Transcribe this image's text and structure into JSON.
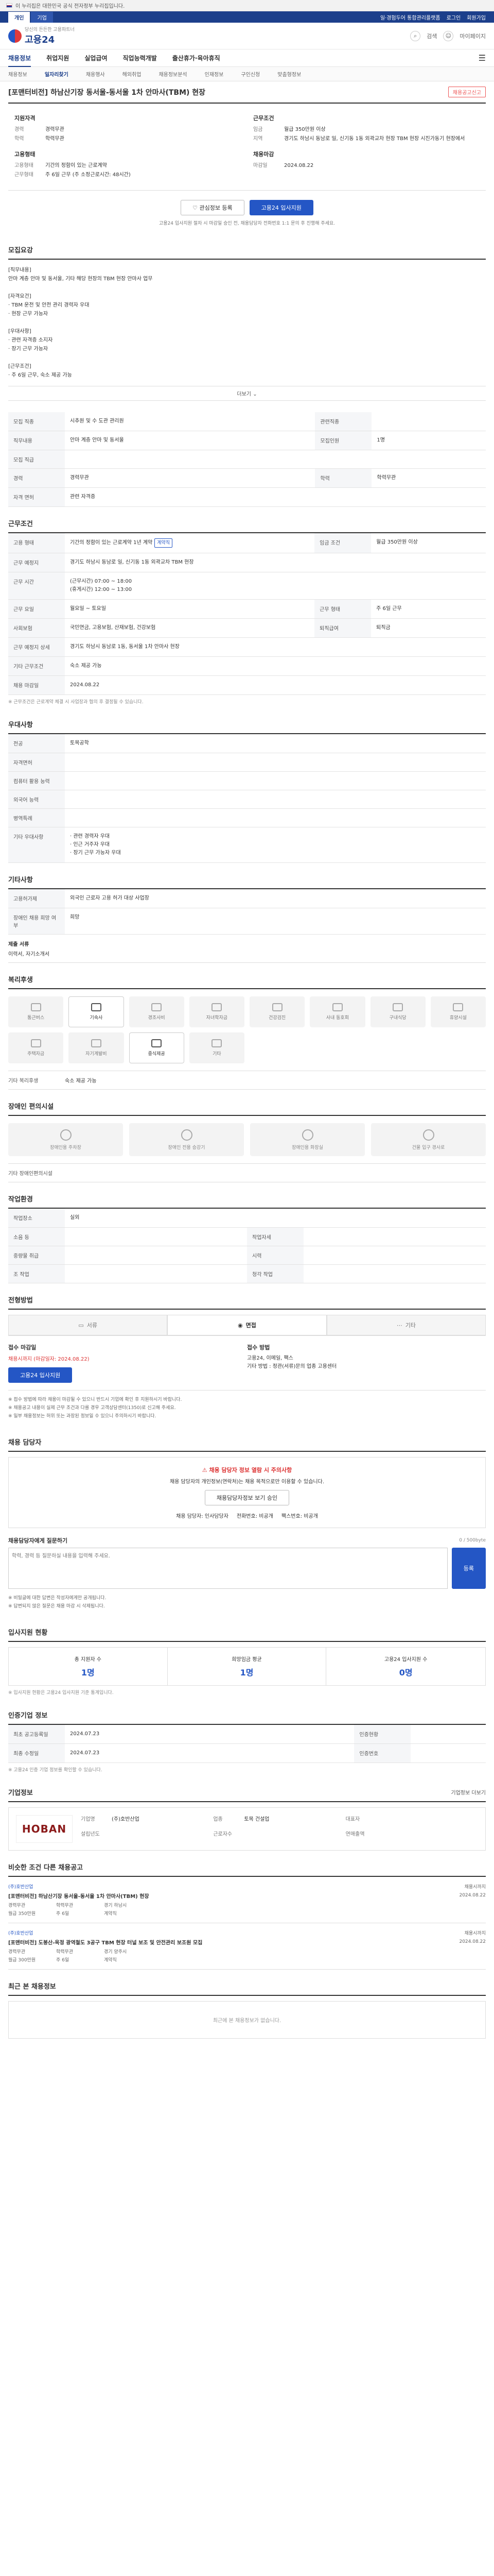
{
  "gov": {
    "text": "이 누리집은 대한민국 공식 전자정부 누리집입니다."
  },
  "util": {
    "tabs": [
      "개인",
      "기업"
    ],
    "links": [
      "일·경험두어 통합관리플랫폼",
      "로그인",
      "회원가입"
    ]
  },
  "header": {
    "logo": "고용24",
    "logo_sub": "당신의 든든한 고용파트너",
    "search_label": "검색",
    "mypage_label": "마이페이지"
  },
  "gnb": [
    "채용정보",
    "취업지원",
    "실업급여",
    "직업능력개발",
    "출산휴가·육아휴직",
    "전체메뉴"
  ],
  "lnb": [
    "채용정보",
    "일자리찾기",
    "채용행사",
    "해외취업",
    "채용정보분석",
    "인재정보",
    "구인신청",
    "맞춤형정보"
  ],
  "job": {
    "title": "[포맨터비전] 하남산기장 동서울-동서울 1차 안마사(TBM) 현장",
    "report": "채용공고신고"
  },
  "summary": {
    "recruit_title": "지원자격",
    "recruit": [
      {
        "k": "경력",
        "v": "경력무관"
      },
      {
        "k": "학력",
        "v": "학력무관"
      }
    ],
    "cond_title": "근무조건",
    "cond": [
      {
        "k": "임금",
        "v": "월급 350만원 이상"
      },
      {
        "k": "지역",
        "v": "경기도 하남시 동남로 일, 신기동 1동 외곽교차 현장 TBM 현장 시진가동기 현장에서"
      }
    ],
    "type_title": "고용형태",
    "type": [
      {
        "k": "고용형태",
        "v": "기간의 정함이 있는 근로계약"
      },
      {
        "k": "근무형태",
        "v": "주 6일 근무 (주 소정근로시간: 48시간)"
      }
    ],
    "deadline_title": "채용마감",
    "deadline": [
      {
        "k": "마감일",
        "v": "2024.08.22"
      },
      {
        "k": "",
        "v": ""
      }
    ]
  },
  "apply": {
    "scrap": "관심정보 등록",
    "online": "고용24 입사지원",
    "notice": "고용24 입사지원 절차 시 마감일 승인 전, 채용담당자 전화번호 1:1 문의 후 진행해 주세요."
  },
  "job_content": {
    "title": "모집요강",
    "body": "[직무내용]\n안마 계층 안마 및 동서울, 기타 해당 현장의 TBM 현장 안마사 업무\n\n[자격요건]\n· TBM 운전 및 안전 관리 경력자 우대\n· 현장 근무 가능자\n\n[우대사항]\n· 관련 자격증 소지자\n· 장기 근무 가능자\n\n[근무조건]\n· 주 6일 근무, 숙소 제공 가능",
    "more": "더보기"
  },
  "req": {
    "rows": [
      {
        "k": "모집 직종",
        "v": "시추원 및 수 도관 관리원",
        "k2": "관련직종",
        "v2": ""
      },
      {
        "k": "직무내용",
        "v": "안마 계층 안마 및 동서울",
        "k2": "모집인원",
        "v2": "1명"
      },
      {
        "k": "모집 직급",
        "v": "",
        "k2": "",
        "v2": ""
      },
      {
        "k": "경력",
        "v": "경력무관",
        "k2": "학력",
        "v2": "학력무관"
      },
      {
        "k": "자격 면허",
        "v": "관련 자격증",
        "k2": "",
        "v2": ""
      }
    ]
  },
  "work": {
    "title": "근무조건",
    "rows": [
      {
        "k": "고용 형태",
        "v": "기간의 정함이 있는 근로계약 1년 계약",
        "pill": "계약직",
        "k2": "임금 조건",
        "v2": "월급 350만원 이상"
      },
      {
        "k": "근무 예정지",
        "v": "경기도 하남시 동남로 일, 신기동 1동 외곽교차 TBM 현장",
        "k2": "",
        "v2": ""
      },
      {
        "k": "근무 시간",
        "v": "(근무시간) 07:00 ~ 18:00\n(휴게시간) 12:00 ~ 13:00",
        "k2": "",
        "v2": ""
      },
      {
        "k": "근무 요일",
        "v": "월요일 ~ 토요일",
        "k2": "근무 형태",
        "v2": "주 6일 근무"
      },
      {
        "k": "사회보험",
        "v": "국민연금, 고용보험, 산재보험, 건강보험",
        "k2": "퇴직급여",
        "v2": "퇴직금"
      },
      {
        "k": "근무 예정지 상세",
        "v": "경기도 하남시 동남로 1동, 동서울 1차 안마사 현장",
        "k2": "",
        "v2": ""
      },
      {
        "k": "기타 근무조건",
        "v": "숙소 제공 가능",
        "k2": "",
        "v2": ""
      },
      {
        "k": "채용 마감일",
        "v": "2024.08.22",
        "k2": "",
        "v2": ""
      }
    ],
    "note": "※ 근무조건은 근로계약 체결 시 사업장과 협의 후 결정될 수 있습니다."
  },
  "welfare_req": {
    "title": "우대사항",
    "rows": [
      {
        "k": "전공",
        "v": "토목공학"
      },
      {
        "k": "자격면허",
        "v": ""
      },
      {
        "k": "컴퓨터 활용 능력",
        "v": ""
      },
      {
        "k": "외국어 능력",
        "v": ""
      },
      {
        "k": "병역특례",
        "v": ""
      },
      {
        "k": "기타 우대사항",
        "v": "· 관련 경력자 우대\n· 인근 거주자 우대\n· 장기 근무 가능자 우대"
      }
    ]
  },
  "etc": {
    "title": "기타사항",
    "rows": [
      {
        "k": "고용허가제",
        "v": "외국인 근로자 고용 허가 대상 사업장"
      },
      {
        "k": "장애인 채용 희망 여부",
        "v": "희망"
      }
    ],
    "docs_title": "제출 서류",
    "docs": "이력서, 자기소개서"
  },
  "welfare": {
    "title": "복리후생",
    "items": [
      {
        "label": "통근버스",
        "on": false
      },
      {
        "label": "기숙사",
        "on": true
      },
      {
        "label": "경조사비",
        "on": false
      },
      {
        "label": "자녀학자금",
        "on": false
      },
      {
        "label": "건강검진",
        "on": false
      },
      {
        "label": "사내 동호회",
        "on": false
      },
      {
        "label": "구내식당",
        "on": false
      },
      {
        "label": "휴양시설",
        "on": false
      },
      {
        "label": "주택자금",
        "on": false
      },
      {
        "label": "자기계발비",
        "on": false
      },
      {
        "label": "중식제공",
        "on": true
      },
      {
        "label": "기타",
        "on": false
      }
    ],
    "extra_label": "기타 복리후생",
    "extra": "숙소 제공 가능"
  },
  "facility": {
    "title": "장애인 편의시설",
    "items": [
      "장애인용 주차장",
      "장애인 전용 승강기",
      "장애인용 화장실",
      "건물 입구 경사로"
    ],
    "extra_label": "기타 장애인편의시설",
    "extra": ""
  },
  "work_env": {
    "title": "작업환경",
    "rows": [
      {
        "k": "작업장소",
        "v": "실외",
        "k2": "",
        "v2": ""
      },
      {
        "k": "소음 등",
        "v": "",
        "k2": "작업자세",
        "v2": ""
      },
      {
        "k": "중량물 취급",
        "v": "",
        "k2": "시력",
        "v2": ""
      },
      {
        "k": "조 작업",
        "v": "",
        "k2": "청각 작업",
        "v2": ""
      }
    ]
  },
  "method": {
    "title": "전형방법",
    "tabs": [
      "서류",
      "면접",
      "기타"
    ],
    "left_title": "접수 마감일",
    "left_value": "채용시까지 (마감일자: 2024.08.22)",
    "left_btn": "고용24 입사지원",
    "right_title": "접수 방법",
    "right_value": "고용24, 이메일, 팩스\n기타 방법 : 정관(서류)문의 업종 고용센터",
    "bullets": [
      "※ 접수 방법에 따라 채용이 마감될 수 있으니 반드시 기업에 확인 후 지원하시기 바랍니다.",
      "※ 채용공고 내용이 실제 근무 조건과 다를 경우 고객상담센터(1350)로 신고해 주세요.",
      "※ 일부 채용정보는 허위 또는 과장된 정보일 수 있으니 주의하시기 바랍니다."
    ]
  },
  "contact": {
    "title": "채용 담당자",
    "warn": "채용 담당자 정보 열람 시 주의사항",
    "desc": "채용 담당자의 개인정보(연락처)는 채용 목적으로만 이용할 수 있습니다.",
    "btn": "채용담당자정보 보기 승인",
    "f1_label": "채용 담당자",
    "f1": "인사담당자",
    "f2_label": "전화번호",
    "f2": "비공개",
    "f3_label": "팩스번호",
    "f3": "비공개"
  },
  "qna": {
    "title": "채용담당자에게 질문하기",
    "placeholder": "학력, 경력 등 질문하실 내용을 입력해 주세요.",
    "counter": "0 / 500byte",
    "btn": "등록",
    "notes": [
      "※ 비밀글에 대한 답변은 작성자에게만 공개됩니다.",
      "※ 답변되지 않은 질문은 채용 마감 시 삭제됩니다."
    ]
  },
  "stats": {
    "title": "입사지원 현황",
    "items": [
      {
        "label": "총 지원자 수",
        "num": "1명"
      },
      {
        "label": "희망임금 평균",
        "num": "1명"
      },
      {
        "label": "고용24 입사지원 수",
        "num": "0명"
      }
    ],
    "note": "※ 입사지원 현황은 고용24 입사지원 기준 통계입니다."
  },
  "announce": {
    "title": "인증기업 정보",
    "rows": [
      {
        "k": "최초 공고등록일",
        "v": "2024.07.23",
        "k2": "인증현황",
        "v2": ""
      },
      {
        "k": "최종 수정일",
        "v": "2024.07.23",
        "k2": "인증번호",
        "v2": ""
      }
    ],
    "note": "※ 고용24 인증 기업 정보를 확인할 수 있습니다."
  },
  "company": {
    "title": "기업정보",
    "logo": "HOBAN",
    "more": "기업정보 더보기",
    "fields": [
      {
        "k": "기업명",
        "v": "(주)호반산업"
      },
      {
        "k": "업종",
        "v": "토목 건설업"
      },
      {
        "k": "대표자",
        "v": ""
      },
      {
        "k": "설립년도",
        "v": ""
      },
      {
        "k": "근로자수",
        "v": ""
      },
      {
        "k": "연매출액",
        "v": ""
      }
    ]
  },
  "similar": {
    "title": "비슷한 조건 다른 채용공고",
    "items": [
      {
        "company": "(주)호반산업",
        "title": "[포맨터비전] 하남산기장 동서울-동서울 1차 안마사(TBM) 현장",
        "meta": [
          "경력무관",
          "학력무관",
          "경기 하남시",
          "월급 350만원",
          "주 6일",
          "계약직"
        ],
        "side": "채용시까지\n2024.08.22"
      },
      {
        "company": "(주)호반산업",
        "title": "[포맨터비전] 도봉산-옥정 광역철도 3공구 TBM 현장 터널 보조 및 안전관리 보조원 모집",
        "meta": [
          "경력무관",
          "학력무관",
          "경기 양주시",
          "월급 300만원",
          "주 6일",
          "계약직"
        ],
        "side": "채용시까지\n2024.08.22"
      }
    ]
  },
  "recent": {
    "title": "최근 본 채용정보",
    "empty": "최근에 본 채용정보가 없습니다."
  }
}
